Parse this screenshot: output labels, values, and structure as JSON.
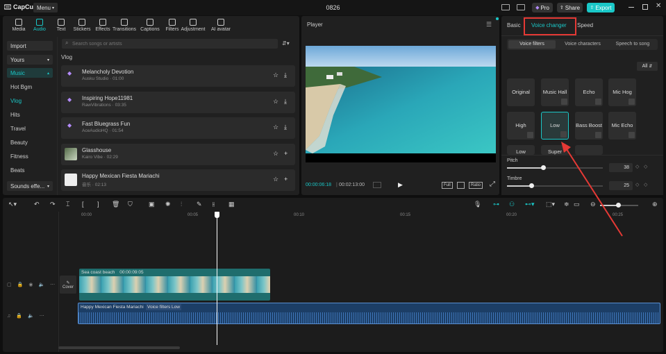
{
  "titlebar": {
    "app_name": "CapCut",
    "menu_label": "Menu",
    "project_title": "0826",
    "pro_label": "Pro",
    "share_label": "Share",
    "export_label": "Export"
  },
  "toolbar": {
    "tabs": [
      {
        "label": "Media",
        "icon": "media-icon"
      },
      {
        "label": "Audio",
        "icon": "audio-icon"
      },
      {
        "label": "Text",
        "icon": "text-icon"
      },
      {
        "label": "Stickers",
        "icon": "stickers-icon"
      },
      {
        "label": "Effects",
        "icon": "effects-icon"
      },
      {
        "label": "Transitions",
        "icon": "transitions-icon"
      },
      {
        "label": "Captions",
        "icon": "captions-icon"
      },
      {
        "label": "Filters",
        "icon": "filters-icon"
      },
      {
        "label": "Adjustment",
        "icon": "adjustment-icon"
      },
      {
        "label": "AI avatar",
        "icon": "ai-avatar-icon"
      }
    ],
    "active_tab": "Audio"
  },
  "audio_sidebar": {
    "import_label": "Import",
    "yours_label": "Yours",
    "music_label": "Music",
    "items": [
      "Hot Bgm",
      "Vlog",
      "Hits",
      "Travel",
      "Beauty",
      "Fitness",
      "Beats"
    ],
    "active_item": "Vlog",
    "sounds_label": "Sounds effe..."
  },
  "search": {
    "placeholder": "Search songs or artists"
  },
  "song_list": {
    "section_title": "Vlog",
    "songs": [
      {
        "title": "Melancholy Devotion",
        "subtitle": "Ausku Studio · 01:00"
      },
      {
        "title": "Inspiring Hope11981",
        "subtitle": "RawVibrations · 03:35"
      },
      {
        "title": "Fast Bluegrass Fun",
        "subtitle": "AceAudioHQ · 01:54"
      },
      {
        "title": "Glasshouse",
        "subtitle": "Kairo Vibe · 02:29"
      },
      {
        "title": "Happy Mexican Fiesta Mariachi",
        "subtitle": "音乐 · 02:13"
      }
    ]
  },
  "player": {
    "title": "Player",
    "current_time": "00:00:06:18",
    "total_time": "00:02:13:00",
    "full_label": "Full",
    "ratio_label": "Ratio"
  },
  "right_panel": {
    "tabs": [
      "Basic",
      "Voice changer",
      "Speed"
    ],
    "active_tab": "Voice changer",
    "sub_tabs": [
      "Voice filters",
      "Voice characters",
      "Speech to song"
    ],
    "active_sub_tab": "Voice filters",
    "filter_all_label": "All",
    "voice_filters": [
      "Original",
      "Music Hall",
      "Echo",
      "Mic Hog",
      "High",
      "Low",
      "Bass Boost",
      "Mic Echo",
      "Low",
      "Super",
      ""
    ],
    "selected_filter": "Low",
    "pitch_label": "Pitch",
    "pitch_value": "38",
    "pitch_level": 0.38,
    "timbre_label": "Timbre",
    "timbre_value": "25",
    "timbre_level": 0.25
  },
  "timeline": {
    "ruler_labels": [
      "00:00",
      "00:05",
      "00:10",
      "00:15",
      "00:20",
      "00:25"
    ],
    "cover_label": "Cover",
    "video_clip_label": "Sea coast beach",
    "video_clip_duration": "00:00:09:05",
    "audio_clip_label": "Happy Mexican Fiesta Mariachi",
    "audio_clip_tag": "Voice filters Low"
  },
  "colors": {
    "accent": "#1ac8c8",
    "highlight_red": "#e53935"
  }
}
